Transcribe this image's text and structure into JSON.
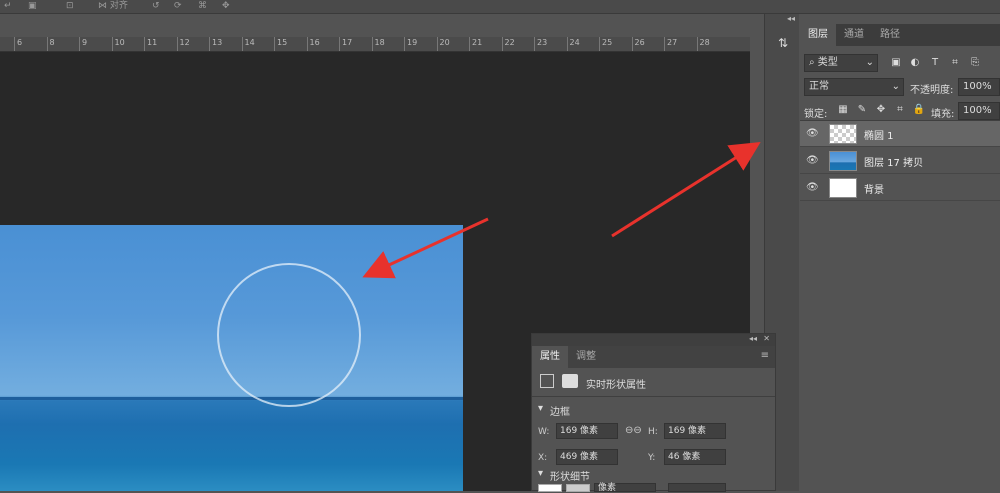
{
  "topbar": {
    "items": [
      "↵",
      "▣",
      "⊡",
      "⋈ 对齐",
      "↺",
      "⟳",
      "⌘",
      "✥"
    ]
  },
  "ruler": {
    "ticks": [
      "6",
      "8",
      "9",
      "10",
      "11",
      "12",
      "13",
      "14",
      "15",
      "16",
      "17",
      "18",
      "19",
      "20",
      "21",
      "22",
      "23",
      "24",
      "25",
      "26",
      "27",
      "28"
    ]
  },
  "layers_panel": {
    "tabs": [
      "图层",
      "通道",
      "路径"
    ],
    "filter_label": "类型",
    "blend_mode": "正常",
    "opacity_label": "不透明度:",
    "opacity_value": "100%",
    "lock_label": "锁定:",
    "fill_label": "填充:",
    "fill_value": "100%",
    "layers": [
      {
        "name": "椭圆 1",
        "selected": true
      },
      {
        "name": "图层 17 拷贝",
        "selected": false
      },
      {
        "name": "背景",
        "selected": false
      }
    ]
  },
  "properties_panel": {
    "tabs": [
      "属性",
      "调整"
    ],
    "title": "实时形状属性",
    "section_bounds": "边框",
    "w_label": "W:",
    "w_value": "169 像素",
    "h_label": "H:",
    "h_value": "169 像素",
    "x_label": "X:",
    "x_value": "469 像素",
    "y_label": "Y:",
    "y_value": "46 像素",
    "section_shape": "形状细节",
    "stroke_value": "像素"
  },
  "colors": {
    "arrow": "#e8322c",
    "canvas": "#282828",
    "panel": "#535353"
  }
}
